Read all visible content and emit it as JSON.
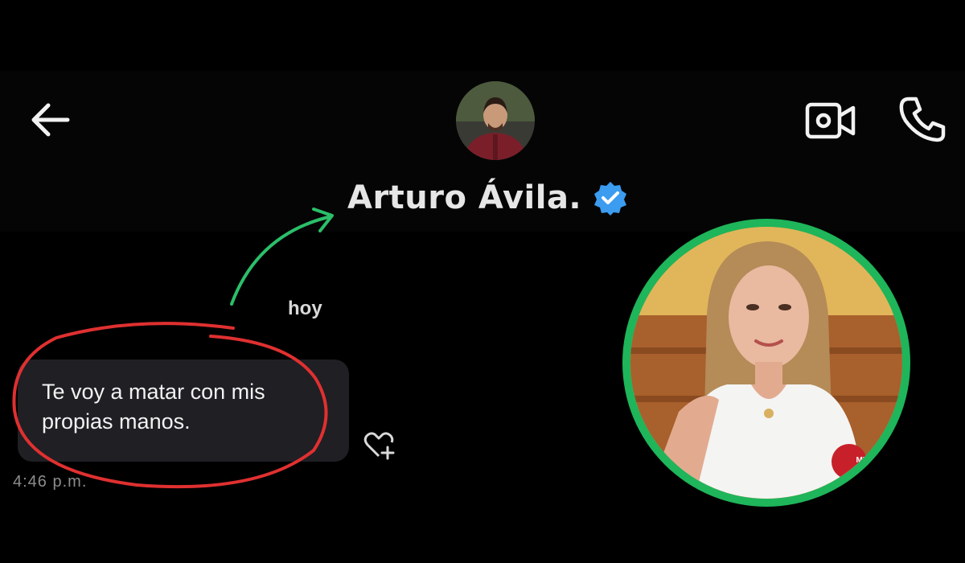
{
  "header": {
    "contact_name": "Arturo Ávila.",
    "back_icon": "arrow-left-icon",
    "verified_icon": "verified-badge-icon",
    "video_icon": "video-camera-icon",
    "call_icon": "phone-icon"
  },
  "conversation": {
    "date_separator": "hoy",
    "messages": [
      {
        "text": "Te voy a matar con mis propias manos.",
        "time": "4:46 p.m.",
        "reaction_icon": "heart-plus-icon"
      }
    ]
  },
  "overlay": {
    "photo_badge": "MH",
    "colors": {
      "frame": "#1fb55a",
      "arrow": "#2bbf6a",
      "highlight_circle": "#e03030",
      "verified": "#3b9cf0"
    }
  }
}
